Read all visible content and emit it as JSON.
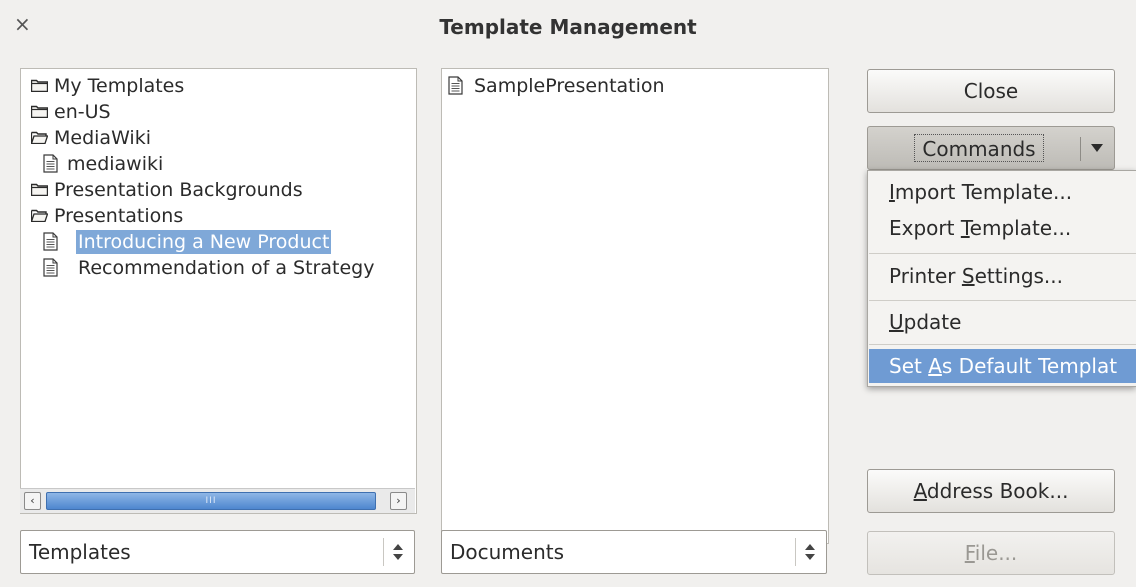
{
  "window": {
    "title": "Template Management",
    "close_glyph": "×"
  },
  "left_tree": {
    "items": [
      {
        "label": "My Templates",
        "icon": "folder-icon"
      },
      {
        "label": "en-US",
        "icon": "folder-icon"
      },
      {
        "label": "MediaWiki",
        "icon": "folder-open-icon"
      },
      {
        "label": "mediawiki",
        "icon": "document-icon"
      },
      {
        "label": "Presentation Backgrounds",
        "icon": "folder-icon"
      },
      {
        "label": "Presentations",
        "icon": "folder-open-icon"
      },
      {
        "label": "Introducing a New Product",
        "icon": "document-icon",
        "selected": true
      },
      {
        "label": "Recommendation of a Strategy",
        "icon": "document-icon"
      }
    ],
    "scrollbar_grip": "III"
  },
  "right_list": {
    "items": [
      {
        "label": "SamplePresentation",
        "icon": "document-icon"
      }
    ]
  },
  "buttons": {
    "close": "Close",
    "commands": "Commands",
    "address_book": {
      "pre": "",
      "mnemonic": "A",
      "post": "ddress Book..."
    },
    "file": {
      "pre": "",
      "mnemonic": "F",
      "post": "ile..."
    }
  },
  "commands_menu": [
    {
      "pre": "",
      "mnemonic": "I",
      "post": "mport Template..."
    },
    {
      "pre": "Export ",
      "mnemonic": "T",
      "post": "emplate..."
    },
    {
      "pre": "Printer ",
      "mnemonic": "S",
      "post": "ettings..."
    },
    {
      "pre": "",
      "mnemonic": "U",
      "post": "pdate"
    },
    {
      "pre": "Set ",
      "mnemonic": "A",
      "post": "s Default Templat",
      "active": true
    }
  ],
  "combos": {
    "left": "Templates",
    "right": "Documents"
  },
  "colors": {
    "selection": "#7fa8d8",
    "menu_highlight": "#6f9bd3",
    "background": "#f1f0ee"
  }
}
